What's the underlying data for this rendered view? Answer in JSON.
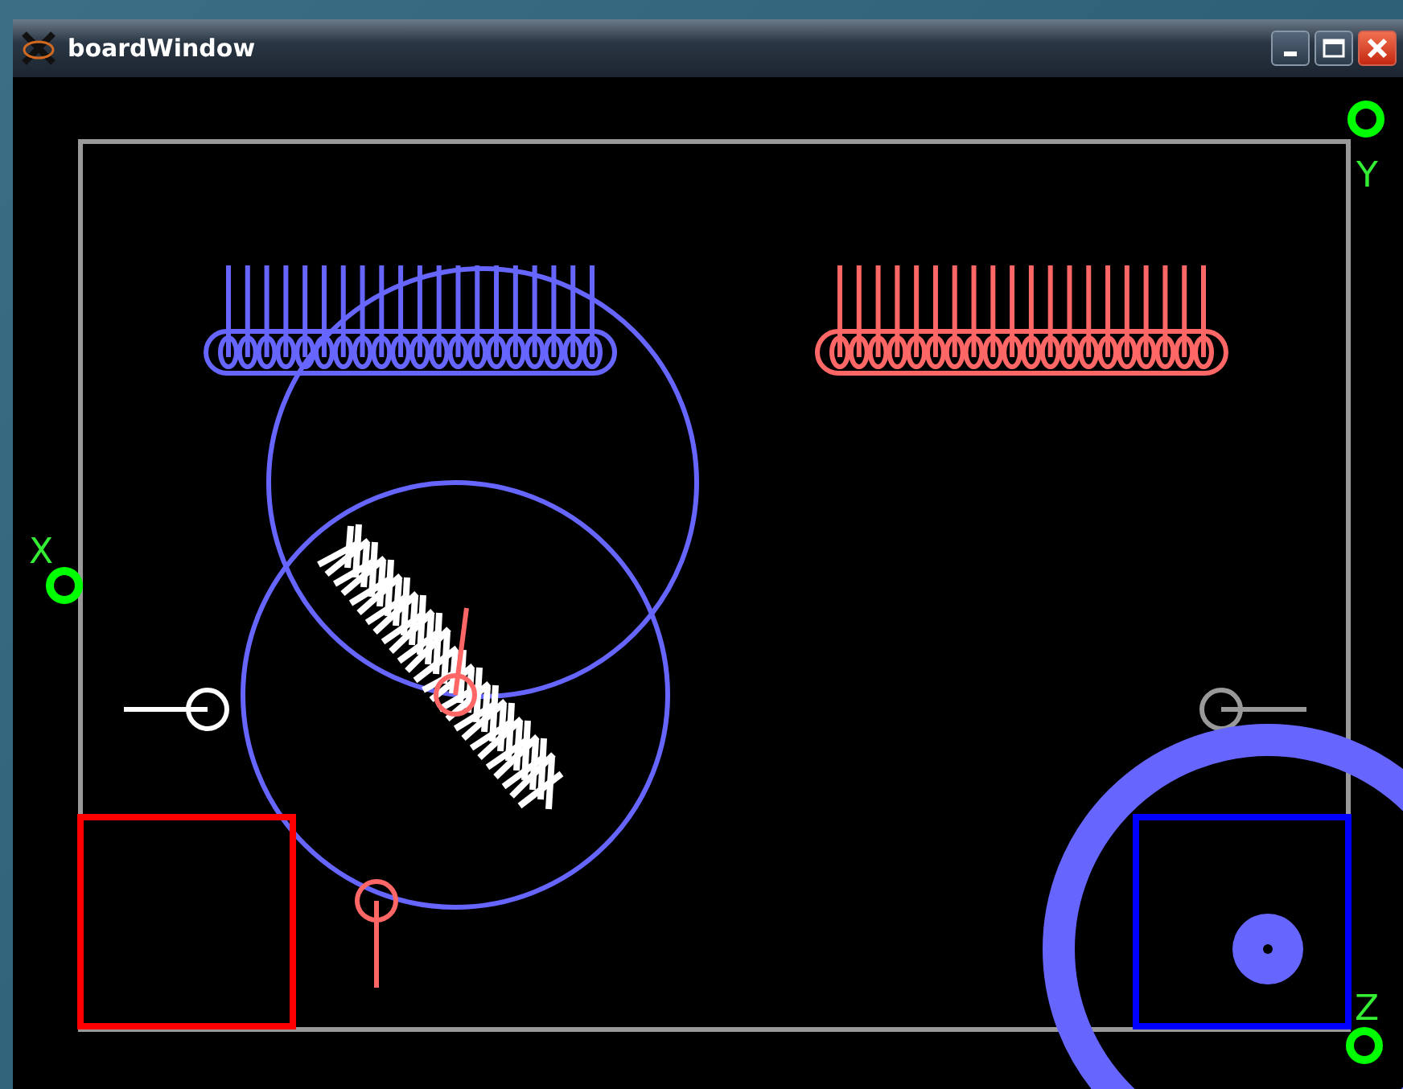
{
  "window": {
    "title": "boardWindow"
  },
  "axis_labels": [
    {
      "text": "Y"
    },
    {
      "text": "X"
    },
    {
      "text": "Z"
    }
  ]
}
